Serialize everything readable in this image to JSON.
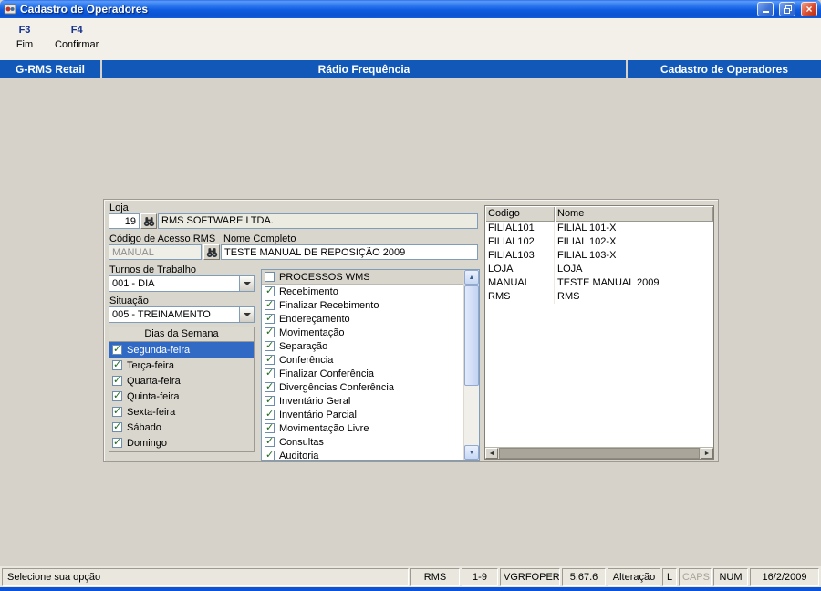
{
  "window": {
    "title": "Cadastro de Operadores",
    "controls": {
      "close": "×"
    }
  },
  "toolbar": {
    "buttons": [
      {
        "key": "F3",
        "label": "Fim"
      },
      {
        "key": "F4",
        "label": "Confirmar"
      }
    ]
  },
  "breadcrumb": {
    "left": "G-RMS Retail",
    "center": "Rádio Frequência",
    "right": "Cadastro de Operadores"
  },
  "form": {
    "loja": {
      "label": "Loja",
      "code": "19",
      "name": "RMS SOFTWARE LTDA."
    },
    "codigo": {
      "label": "Código de Acesso RMS",
      "value": "MANUAL"
    },
    "nome": {
      "label": "Nome Completo",
      "value": "TESTE MANUAL DE REPOSIÇÃO 2009"
    },
    "turnos": {
      "label": "Turnos de Trabalho",
      "value": "001 - DIA"
    },
    "situacao": {
      "label": "Situação",
      "value": "005 - TREINAMENTO"
    },
    "dias": {
      "header": "Dias da Semana",
      "items": [
        {
          "label": "Segunda-feira",
          "checked": true,
          "selected": true
        },
        {
          "label": "Terça-feira",
          "checked": true,
          "selected": false
        },
        {
          "label": "Quarta-feira",
          "checked": true,
          "selected": false
        },
        {
          "label": "Quinta-feira",
          "checked": true,
          "selected": false
        },
        {
          "label": "Sexta-feira",
          "checked": true,
          "selected": false
        },
        {
          "label": "Sábado",
          "checked": true,
          "selected": false
        },
        {
          "label": "Domingo",
          "checked": true,
          "selected": false
        }
      ]
    }
  },
  "processos": {
    "header": {
      "label": "PROCESSOS WMS",
      "checked": false
    },
    "items": [
      {
        "label": "Recebimento",
        "checked": true
      },
      {
        "label": "Finalizar Recebimento",
        "checked": true
      },
      {
        "label": "Endereçamento",
        "checked": true
      },
      {
        "label": "Movimentação",
        "checked": true
      },
      {
        "label": "Separação",
        "checked": true
      },
      {
        "label": "Conferência",
        "checked": true
      },
      {
        "label": "Finalizar Conferência",
        "checked": true
      },
      {
        "label": "Divergências Conferência",
        "checked": true
      },
      {
        "label": "Inventário Geral",
        "checked": true
      },
      {
        "label": "Inventário Parcial",
        "checked": true
      },
      {
        "label": "Movimentação Livre",
        "checked": true
      },
      {
        "label": "Consultas",
        "checked": true
      },
      {
        "label": "Auditoria",
        "checked": true
      }
    ]
  },
  "filiais_table": {
    "columns": [
      "Codigo",
      "Nome"
    ],
    "rows": [
      [
        "FILIAL101",
        "FILIAL 101-X"
      ],
      [
        "FILIAL102",
        "FILIAL 102-X"
      ],
      [
        "FILIAL103",
        "FILIAL 103-X"
      ],
      [
        "LOJA",
        "LOJA"
      ],
      [
        "MANUAL",
        "TESTE MANUAL 2009"
      ],
      [
        "RMS",
        "RMS"
      ]
    ]
  },
  "statusbar": {
    "message": "Selecione sua opção",
    "cells": [
      {
        "label": "RMS",
        "disabled": false
      },
      {
        "label": "1-9",
        "disabled": false
      },
      {
        "label": "VGRFOPER",
        "disabled": false
      },
      {
        "label": "5.67.6",
        "disabled": false
      },
      {
        "label": "Alteração",
        "disabled": false
      },
      {
        "label": "L",
        "disabled": false
      },
      {
        "label": "CAPS",
        "disabled": true
      },
      {
        "label": "NUM",
        "disabled": false
      },
      {
        "label": "16/2/2009",
        "disabled": false
      }
    ]
  },
  "icons": {
    "lookup": "binoculars-icon",
    "scroll_up": "▲",
    "scroll_down": "▼",
    "scroll_left": "◄",
    "scroll_right": "►",
    "check": "✓"
  },
  "colors": {
    "titlebar_blue": "#0F5CE0",
    "header_bar_blue": "#1158B8",
    "selection_blue": "#316AC5",
    "field_border": "#7F9DB9",
    "bottom_strip": "#0A53D8"
  }
}
